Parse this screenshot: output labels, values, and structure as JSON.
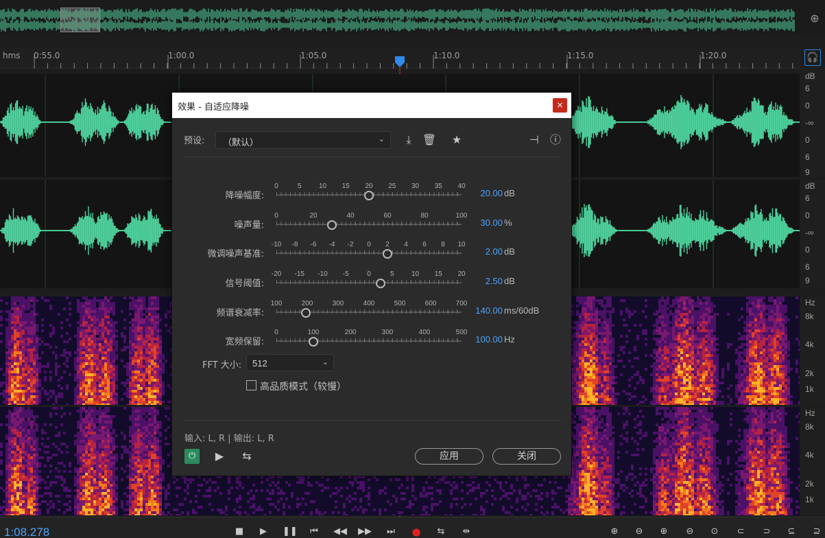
{
  "ruler": {
    "unit": "hms",
    "ticks": [
      {
        "label": "0:55.0"
      },
      {
        "label": "1:00.0"
      },
      {
        "label": "1:05.0"
      },
      {
        "label": "1:10.0"
      },
      {
        "label": "1:15.0"
      },
      {
        "label": "1:20.0"
      }
    ]
  },
  "waveform": {
    "db_labels_top": [
      "dB",
      "6",
      "0",
      "-∞",
      "0",
      "6",
      "9"
    ],
    "db_labels_bottom": [
      "dB",
      "6",
      "0",
      "-∞",
      "0",
      "6",
      "9"
    ],
    "wave_color": "#4fd6a0"
  },
  "spectral": {
    "hz_labels_top": [
      "Hz",
      "8k",
      "4k",
      "2k",
      "1k"
    ],
    "hz_labels_bottom": [
      "Hz",
      "8k",
      "4k",
      "2k",
      "1k"
    ]
  },
  "transport": {
    "time": "1:08.278"
  },
  "dialog": {
    "title": "效果 - 自适应降噪",
    "close_glyph": "×",
    "preset_label": "预设:",
    "preset_value": "（默认）",
    "params": [
      {
        "label": "降噪幅度:",
        "ticks": [
          "0",
          "5",
          "10",
          "15",
          "20",
          "25",
          "30",
          "35",
          "40"
        ],
        "value": "20.00",
        "unit": "dB",
        "fraction": 0.5
      },
      {
        "label": "噪声量:",
        "ticks": [
          "0",
          "20",
          "40",
          "60",
          "80",
          "100"
        ],
        "value": "30.00",
        "unit": "%",
        "fraction": 0.3
      },
      {
        "label": "微调噪声基准:",
        "ticks": [
          "-10",
          "-8",
          "-6",
          "-4",
          "-2",
          "0",
          "2",
          "4",
          "6",
          "8",
          "10"
        ],
        "value": "2.00",
        "unit": "dB",
        "fraction": 0.6
      },
      {
        "label": "信号阈值:",
        "ticks": [
          "-20",
          "-15",
          "-10",
          "-5",
          "0",
          "5",
          "10",
          "15",
          "20"
        ],
        "value": "2.50",
        "unit": "dB",
        "fraction": 0.5625
      },
      {
        "label": "频谱衰减率:",
        "ticks": [
          "100",
          "200",
          "300",
          "400",
          "500",
          "600",
          "700"
        ],
        "value": "140.00",
        "unit": "ms/60dB",
        "fraction": 0.16
      },
      {
        "label": "宽频保留:",
        "ticks": [
          "0",
          "100",
          "200",
          "300",
          "400",
          "500"
        ],
        "value": "100.00",
        "unit": "Hz",
        "fraction": 0.2
      }
    ],
    "fft_label": "FFT 大小:",
    "fft_value": "512",
    "hq_label": "高品质模式（较慢）",
    "io_label": "输入: L, R | 输出: L, R",
    "apply_label": "应用",
    "close_label": "关闭"
  }
}
